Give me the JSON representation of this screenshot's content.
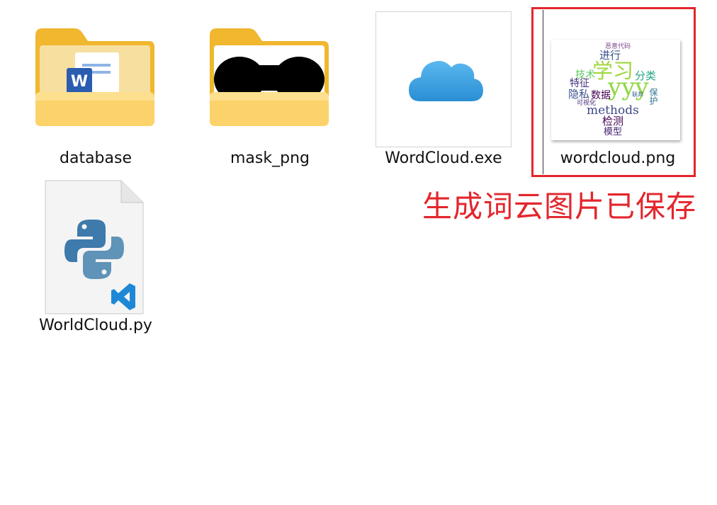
{
  "files": [
    {
      "name": "database",
      "type": "folder",
      "overlay_icon": "word-document-icon"
    },
    {
      "name": "mask_png",
      "type": "folder",
      "overlay_icon": "black-mask-image-icon"
    },
    {
      "name": "WordCloud.exe",
      "type": "executable",
      "icon": "cloud-icon"
    },
    {
      "name": "wordcloud.png",
      "type": "image",
      "icon": "wordcloud-thumbnail"
    },
    {
      "name": "WorldCloud.py",
      "type": "python-file",
      "icon": "python-vscode-icon"
    }
  ],
  "wordcloud_thumbnail": {
    "words": [
      {
        "text": "恶意代码",
        "color": "#7b4a8c"
      },
      {
        "text": "进行",
        "color": "#3b528b"
      },
      {
        "text": "学习",
        "color": "#a0d73f"
      },
      {
        "text": "技术",
        "color": "#5ec962"
      },
      {
        "text": "分类",
        "color": "#21a685"
      },
      {
        "text": "特征",
        "color": "#46337e"
      },
      {
        "text": "yyy",
        "color": "#8fd744"
      },
      {
        "text": "隐私",
        "color": "#3b528b"
      },
      {
        "text": "数据",
        "color": "#440154"
      },
      {
        "text": "联邦",
        "color": "#31688e"
      },
      {
        "text": "保护",
        "color": "#2c728e"
      },
      {
        "text": "可视化",
        "color": "#472d7b"
      },
      {
        "text": "methods",
        "color": "#3e4a89"
      },
      {
        "text": "检测",
        "color": "#440154"
      },
      {
        "text": "模型",
        "color": "#482576"
      }
    ]
  },
  "annotation": {
    "text": "生成词云图片已保存",
    "color": "#e3262c"
  },
  "colors": {
    "folder_back": "#f0b72f",
    "folder_front": "#fcd36a",
    "highlight": "#e3262c",
    "cloud": "#2f95d8",
    "python_blue": "#3e7aab",
    "python_yellow": "#5f93b8",
    "vscode_blue": "#1e88d6"
  }
}
